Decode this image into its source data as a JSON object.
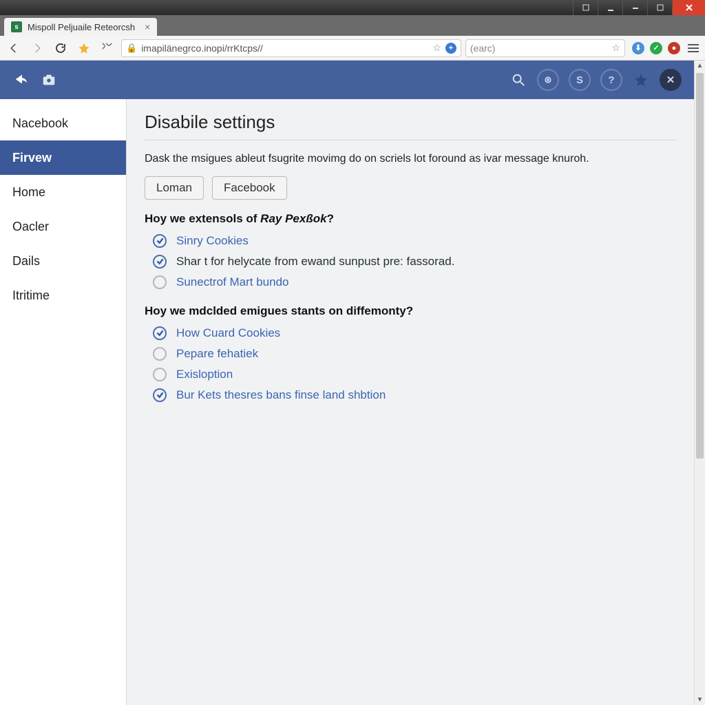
{
  "os": {
    "buttons": [
      "thumb",
      "min",
      "restore",
      "max",
      "close"
    ]
  },
  "browser": {
    "tab_title": "Mispoll Peljuaile Reteorcsh",
    "url": "imapilänegrco.inopi/rrKtcps//",
    "search_placeholder": "(earc)"
  },
  "header": {
    "icons": [
      "logo",
      "camera",
      "search",
      "target",
      "currency",
      "help",
      "star",
      "close"
    ]
  },
  "sidebar": {
    "items": [
      {
        "label": "Nacebook",
        "active": false
      },
      {
        "label": "Firvew",
        "active": true
      },
      {
        "label": "Home",
        "active": false
      },
      {
        "label": "Oacler",
        "active": false
      },
      {
        "label": "Dails",
        "active": false
      },
      {
        "label": "Itritime",
        "active": false
      }
    ]
  },
  "main": {
    "title": "Disabile settings",
    "description": "Dask the msigues ableut fsugrite movimg do on scriels lot foround as ivar message knuroh.",
    "buttons": {
      "loman": "Loman",
      "facebook": "Facebook"
    },
    "section1": {
      "question_prefix": "Hoy we extensols of ",
      "question_em": "Ray Pexßok",
      "question_suffix": "?",
      "options": [
        {
          "label": "Sinry Cookies",
          "checked": true
        },
        {
          "label": "Shar t for helycate from ewand sunpust pre: fassorad.",
          "checked": true,
          "dark": true
        },
        {
          "label": "Sunectrof Mart bundo",
          "checked": false
        }
      ]
    },
    "section2": {
      "question": "Hoy we mdclded emigues stants on diffemonty?",
      "options": [
        {
          "label": "How Cuard Cookies",
          "checked": true
        },
        {
          "label": "Pepare fehatiek",
          "checked": false
        },
        {
          "label": "Exisloption",
          "checked": false
        },
        {
          "label": "Bur Kets thesres bans finse land shbtion",
          "checked": true
        }
      ]
    }
  }
}
